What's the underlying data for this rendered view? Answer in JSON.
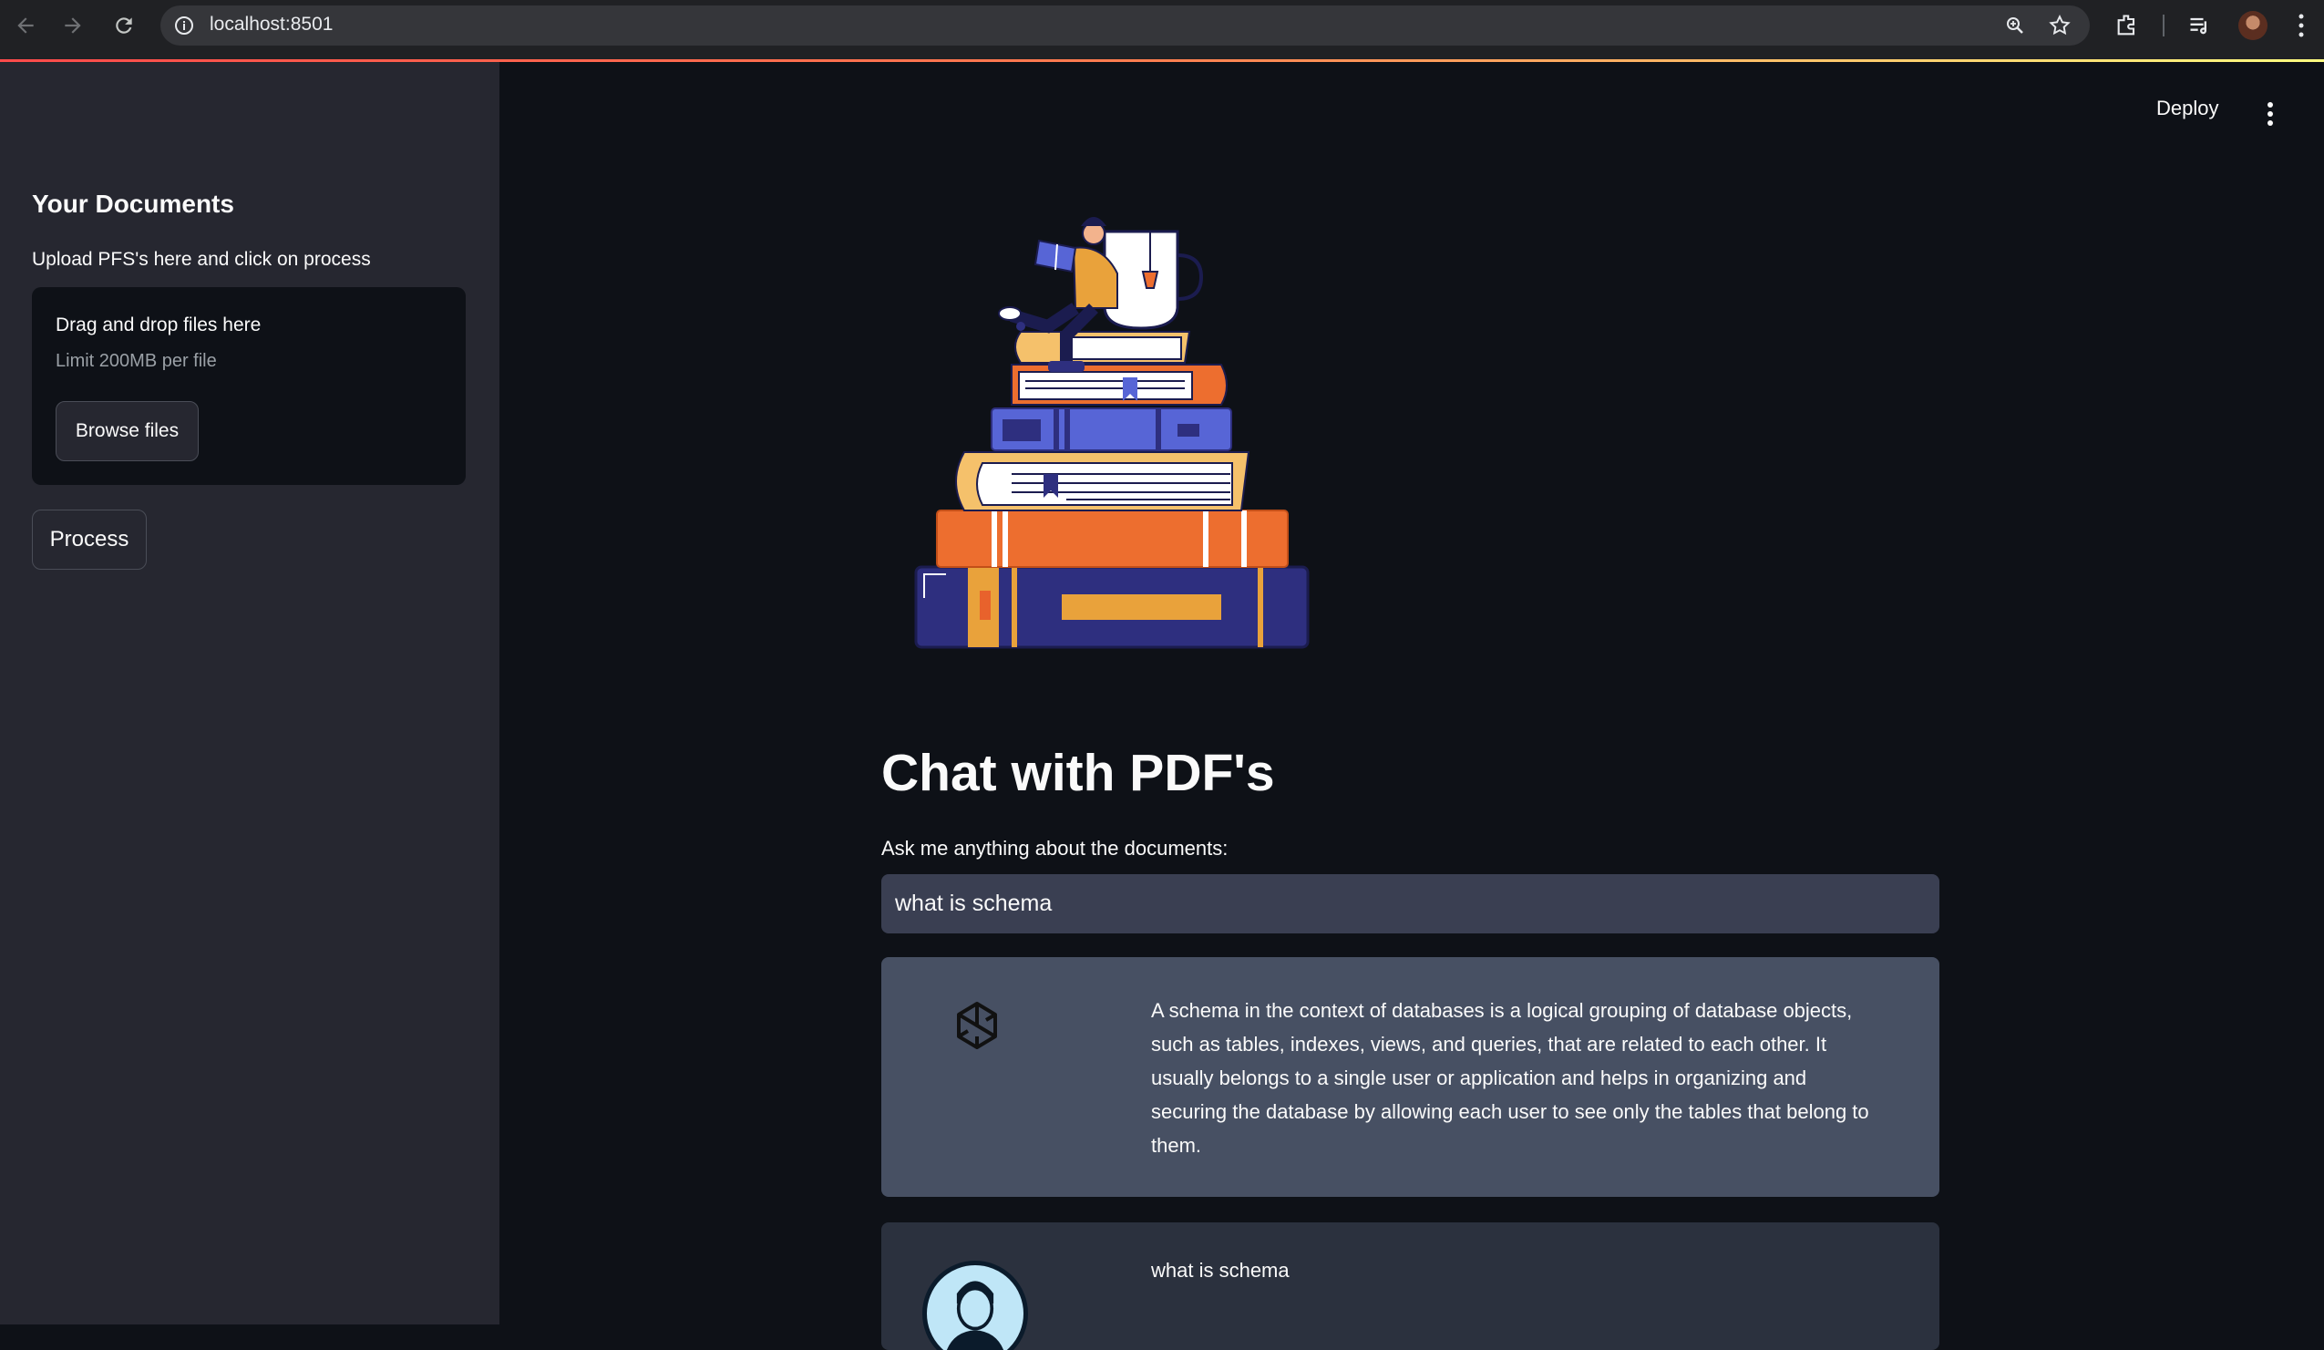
{
  "browser": {
    "url": "localhost:8501"
  },
  "sidebar": {
    "title": "Your Documents",
    "subtitle": "Upload PFS's here and click on process",
    "dropzone": {
      "title": "Drag and drop files here",
      "limit": "Limit 200MB per file",
      "browse_label": "Browse files"
    },
    "process_label": "Process"
  },
  "header": {
    "deploy_label": "Deploy"
  },
  "main": {
    "title": "Chat with PDF's",
    "ask_label": "Ask me anything about the documents:",
    "ask_value": "what is schema",
    "messages": [
      {
        "role": "bot",
        "icon": "openai-icon",
        "text": "A schema in the context of databases is a logical grouping of database objects, such as tables, indexes, views, and queries, that are related to each other. It usually belongs to a single user or application and helps in organizing and securing the database by allowing each user to see only the tables that belong to them."
      },
      {
        "role": "user",
        "icon": "user-avatar",
        "text": "what is schema"
      }
    ]
  },
  "colors": {
    "background": "#0e1117",
    "sidebar": "#262730",
    "input": "#3a3f52",
    "bot_bubble": "#475063",
    "user_bubble": "#2b313e"
  }
}
